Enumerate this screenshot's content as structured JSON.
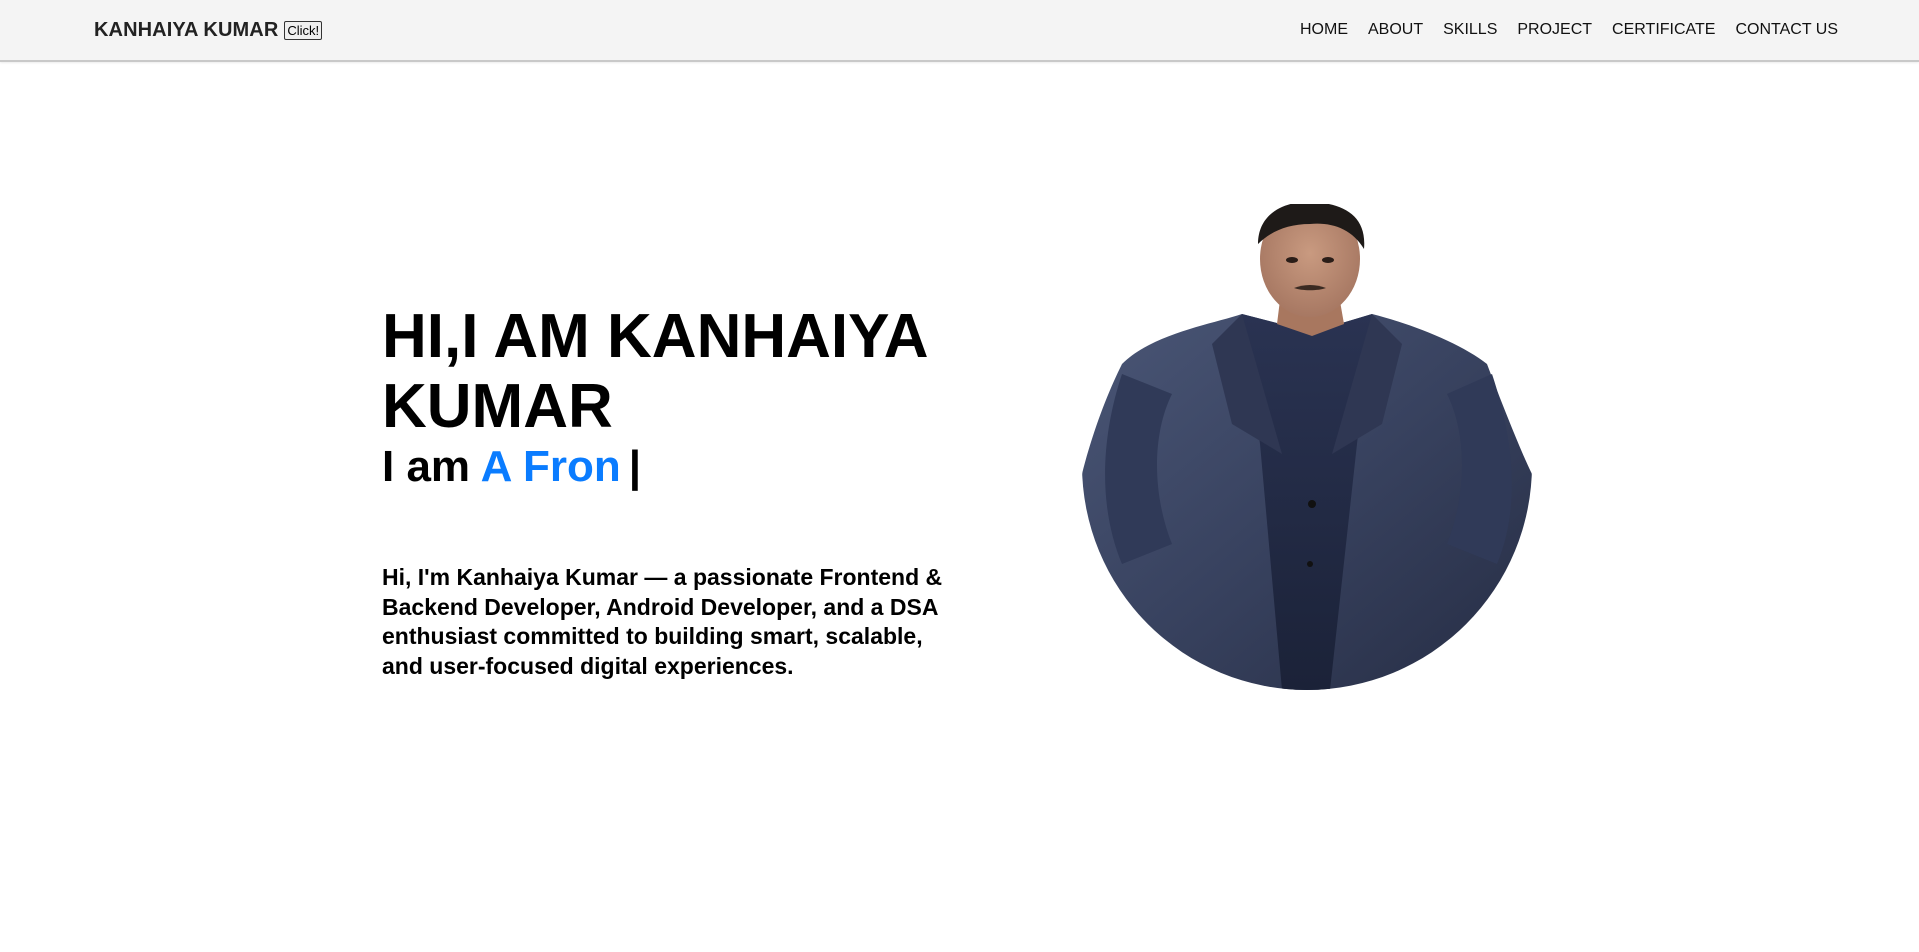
{
  "header": {
    "brand": "KANHAIYA KUMAR",
    "brand_button": "Click!",
    "nav": [
      "HOME",
      "ABOUT",
      "SKILLS",
      "PROJECT",
      "CERTIFICATE",
      "CONTACT US"
    ]
  },
  "hero": {
    "heading_line1": "HI,I AM KANHAIYA",
    "heading_line2": "KUMAR",
    "typed_prefix": "I am ",
    "typed_text": "A Fron",
    "caret": "|",
    "description": "Hi, I'm Kanhaiya Kumar — a passionate Frontend & Backend Developer, Android Developer, and a DSA enthusiast committed to building smart, scalable, and user-focused digital experiences."
  },
  "colors": {
    "accent": "#0a7cff",
    "navbar_bg": "#f4f4f4",
    "text": "#000000"
  }
}
